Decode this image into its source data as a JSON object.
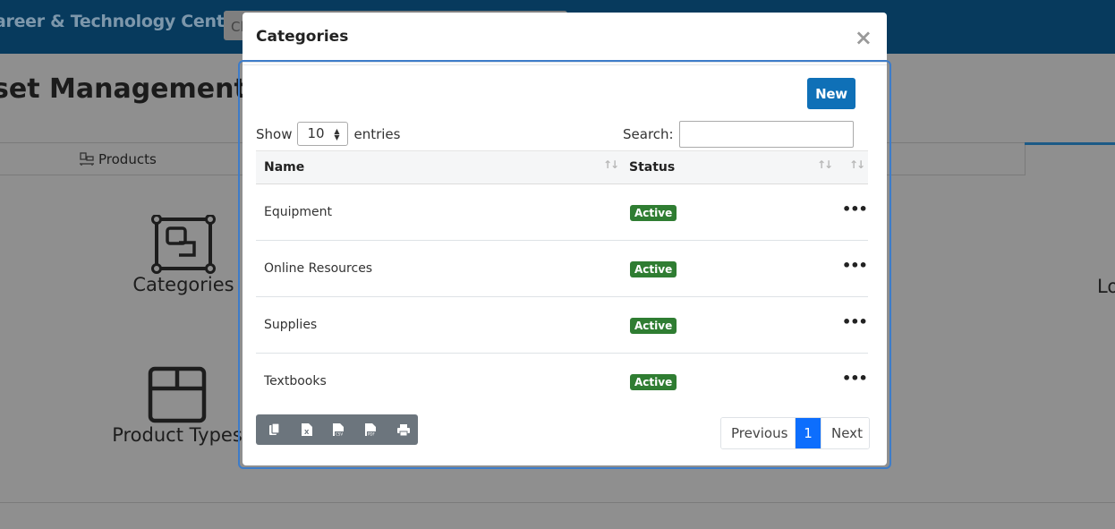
{
  "background": {
    "brand": "areer & Technology Center",
    "search_text": "Cl",
    "page_title": "set Management",
    "tab_products": "Products",
    "tile_categories": "Categories",
    "tile_product_types": "Product Types",
    "tile_partial": "Lo"
  },
  "modal": {
    "title": "Categories",
    "close": "×",
    "new_label": "New",
    "show_label": "Show",
    "entries_label": "entries",
    "page_length": "10",
    "search_label": "Search:",
    "search_value": "",
    "columns": {
      "name": "Name",
      "status": "Status"
    },
    "rows": [
      {
        "name": "Equipment",
        "status": "Active"
      },
      {
        "name": "Online Resources",
        "status": "Active"
      },
      {
        "name": "Supplies",
        "status": "Active"
      },
      {
        "name": "Textbooks",
        "status": "Active"
      }
    ],
    "row_menu": "•••",
    "export_buttons": [
      "copy-icon",
      "excel-icon",
      "csv-icon",
      "pdf-icon",
      "print-icon"
    ],
    "pagination": {
      "previous": "Previous",
      "current": "1",
      "next": "Next"
    }
  },
  "colors": {
    "header_bg": "#073a5d",
    "primary": "#0f70b7",
    "active_badge": "#2f7d32",
    "page_active": "#0d6efd",
    "export_group": "#6c757d"
  }
}
